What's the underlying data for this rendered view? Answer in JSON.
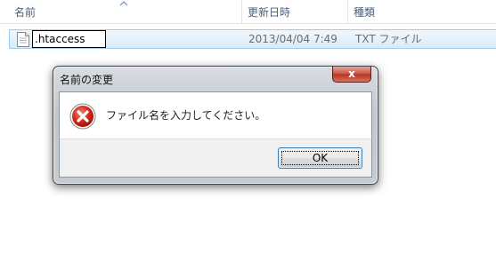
{
  "columns": {
    "name": "名前",
    "date": "更新日時",
    "type": "種類"
  },
  "file": {
    "name_value": ".htaccess",
    "date": "2013/04/04 7:49",
    "type": "TXT ファイル",
    "icon": "text-file-icon"
  },
  "dialog": {
    "title": "名前の変更",
    "close_label": "x",
    "message": "ファイル名を入力してください。",
    "icon": "error-icon",
    "ok_label": "OK"
  }
}
